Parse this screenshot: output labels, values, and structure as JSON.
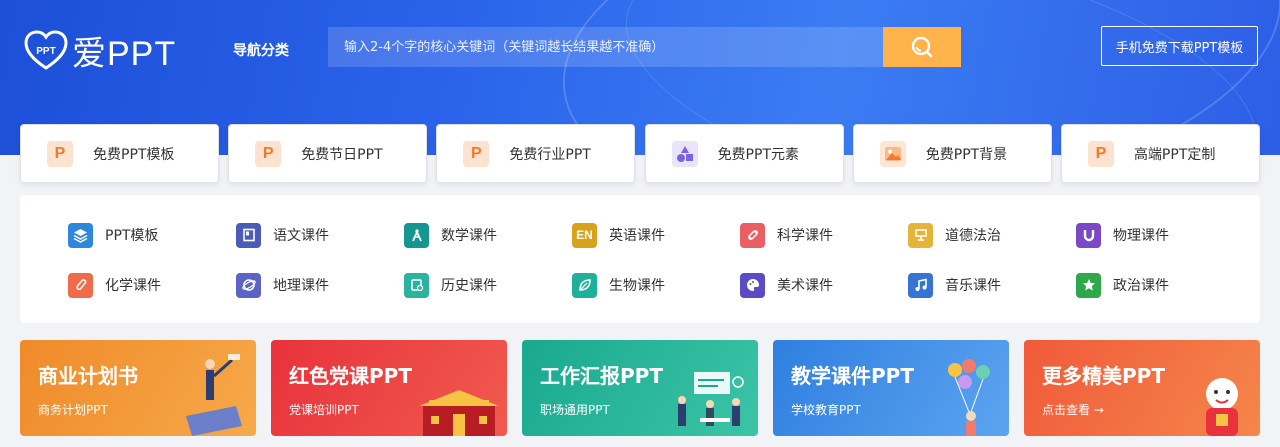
{
  "header": {
    "logo_text": "爱PPT",
    "logo_mark_text": "PPT",
    "nav_category": "导航分类",
    "search_placeholder": "输入2-4个字的核心关键词（关键词越长结果越不准确）",
    "download_button": "手机免费下载PPT模板"
  },
  "categories": [
    {
      "label": "免费PPT模板",
      "icon": "p-icon",
      "glyph": "P"
    },
    {
      "label": "免费节日PPT",
      "icon": "p-icon",
      "glyph": "P"
    },
    {
      "label": "免费行业PPT",
      "icon": "p-icon",
      "glyph": "P"
    },
    {
      "label": "免费PPT元素",
      "icon": "shapes-icon",
      "glyph": ""
    },
    {
      "label": "免费PPT背景",
      "icon": "image-icon",
      "glyph": ""
    },
    {
      "label": "高端PPT定制",
      "icon": "p-icon",
      "glyph": "P"
    }
  ],
  "subjects": [
    {
      "label": "PPT模板",
      "icon": "layers-icon",
      "color": "#2f86dd"
    },
    {
      "label": "语文课件",
      "icon": "book-icon",
      "color": "#4a5cb8"
    },
    {
      "label": "数学课件",
      "icon": "compass-icon",
      "color": "#13978f"
    },
    {
      "label": "英语课件",
      "icon": "en-icon",
      "color": "#d8a21d"
    },
    {
      "label": "科学课件",
      "icon": "flask-icon",
      "color": "#ea5f62"
    },
    {
      "label": "道德法治",
      "icon": "scale-icon",
      "color": "#e5b53a"
    },
    {
      "label": "物理课件",
      "icon": "magnet-icon",
      "color": "#7a49c8"
    },
    {
      "label": "化学课件",
      "icon": "beaker-icon",
      "color": "#ef6b4a"
    },
    {
      "label": "地理课件",
      "icon": "globe-icon",
      "color": "#5c63c6"
    },
    {
      "label": "历史课件",
      "icon": "scroll-icon",
      "color": "#2bb3a0"
    },
    {
      "label": "生物课件",
      "icon": "leaf-icon",
      "color": "#1fb09a"
    },
    {
      "label": "美术课件",
      "icon": "palette-icon",
      "color": "#5a4cc4"
    },
    {
      "label": "音乐课件",
      "icon": "music-icon",
      "color": "#3475d4"
    },
    {
      "label": "政治课件",
      "icon": "star-icon",
      "color": "#2fa84b"
    }
  ],
  "subject_glyphs": {
    "en": "EN"
  },
  "banners": [
    {
      "title": "商业计划书",
      "subtitle": "商务计划PPT",
      "color1": "#f08a2a",
      "color2": "#f6a94a",
      "art": "business-illustration"
    },
    {
      "title": "红色党课PPT",
      "subtitle": "党课培训PPT",
      "color1": "#e8323c",
      "color2": "#f15a4e",
      "art": "gate-illustration"
    },
    {
      "title": "工作汇报PPT",
      "subtitle": "职场通用PPT",
      "color1": "#19a98f",
      "color2": "#3cc4a6",
      "art": "office-illustration"
    },
    {
      "title": "教学课件PPT",
      "subtitle": "学校教育PPT",
      "color1": "#2e7fe0",
      "color2": "#5ca4f0",
      "art": "balloons-illustration"
    },
    {
      "title": "更多精美PPT",
      "subtitle": "点击查看 →",
      "color1": "#f05a3a",
      "color2": "#f5864a",
      "art": "mascot-illustration"
    }
  ],
  "colors": {
    "hero_blue": "#2a63ea",
    "search_button": "#ffb34a",
    "p_icon_bg": "#fde3cf",
    "p_icon_fg": "#f07b2e",
    "shapes_icon_bg": "#e8e4fb",
    "shapes_icon_fg": "#7a62e0",
    "image_icon_bg": "#fde6d4",
    "image_icon_fg": "#f07b2e"
  }
}
